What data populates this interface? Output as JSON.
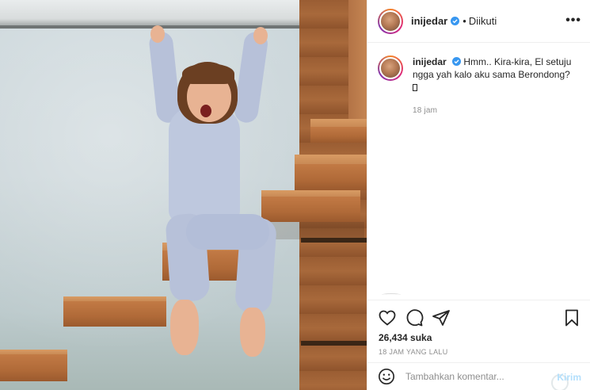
{
  "post": {
    "image_alt": "Child hanging from ceiling above floating wooden stairs"
  },
  "header": {
    "username": "inijedar",
    "separator": "•",
    "follow_status": "Diikuti",
    "more_glyph": "•••"
  },
  "caption": {
    "username": "inijedar",
    "text": "Hmm.. Kira-kira, El setuju ngga yah kalo aku sama Berondong?",
    "time": "18 jam"
  },
  "actions": {
    "likes": "26,434 suka",
    "time_ago": "18 JAM YANG LALU"
  },
  "comment": {
    "placeholder": "Tambahkan komentar...",
    "send_label": "Kirim"
  },
  "colors": {
    "verified": "#3897f0",
    "send_disabled": "#b2dffc",
    "muted": "#8e8e8e"
  },
  "icons": [
    "heart-icon",
    "comment-icon",
    "share-icon",
    "bookmark-icon",
    "emoji-icon",
    "verified-icon",
    "more-icon"
  ]
}
